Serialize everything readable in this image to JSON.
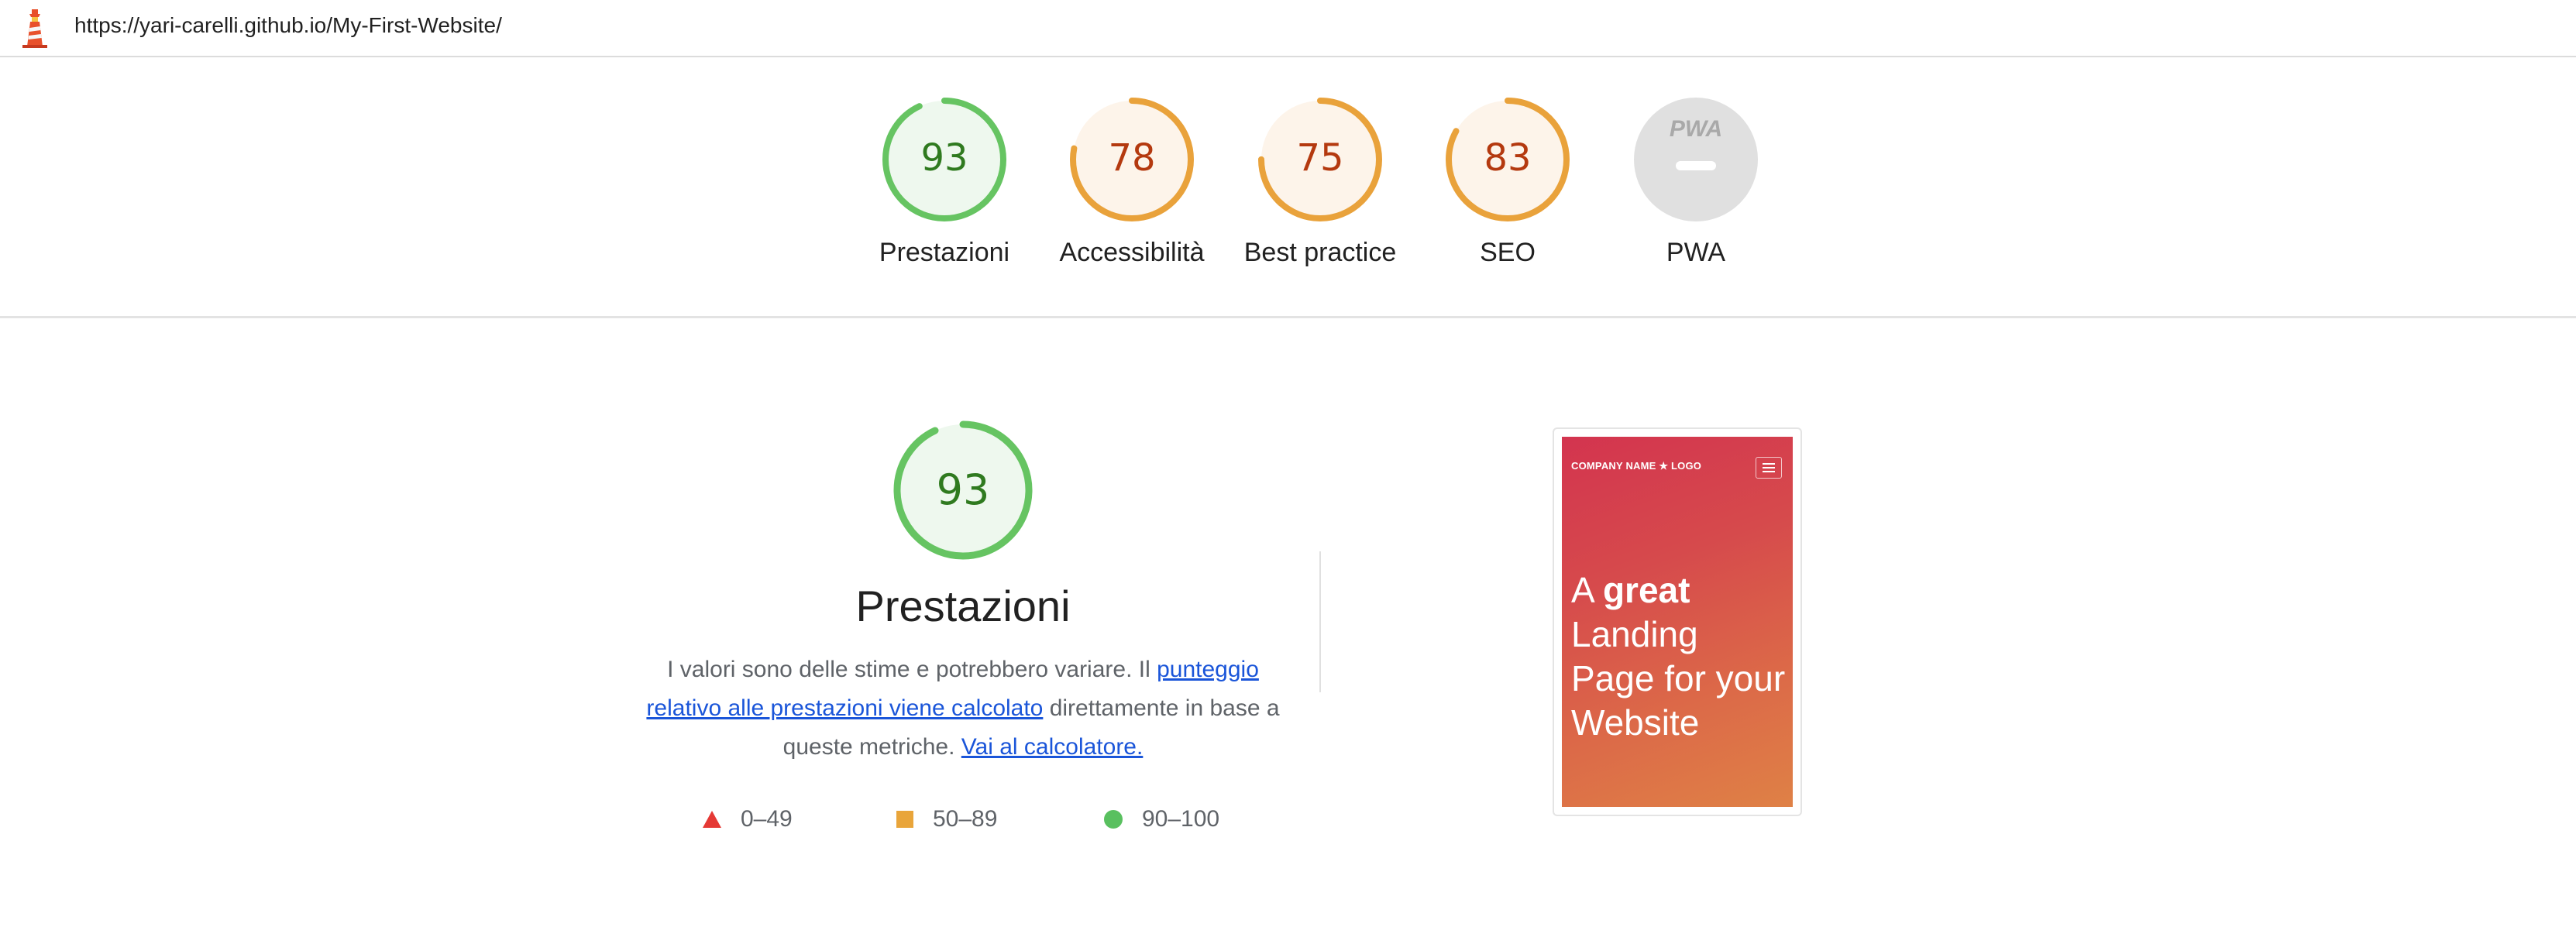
{
  "url": "https://yari-carelli.github.io/My-First-Website/",
  "categories": [
    {
      "label": "Prestazioni",
      "score": 93,
      "rating": "pass"
    },
    {
      "label": "Accessibilità",
      "score": 78,
      "rating": "average"
    },
    {
      "label": "Best practice",
      "score": 75,
      "rating": "average"
    },
    {
      "label": "SEO",
      "score": 83,
      "rating": "average"
    },
    {
      "label": "PWA",
      "score": null,
      "rating": "na"
    }
  ],
  "pwa": {
    "badge_text": "PWA"
  },
  "detail": {
    "score": 93,
    "title": "Prestazioni",
    "desc_part1": "I valori sono delle stime e potrebbero variare. Il ",
    "desc_link1": "punteggio relativo alle prestazioni viene calcolato",
    "desc_part2": " direttamente in base a queste metriche. ",
    "desc_link2": "Vai al calcolatore."
  },
  "legend": [
    {
      "range": "0–49",
      "icon": "triangle-icon",
      "color": "#e53935"
    },
    {
      "range": "50–89",
      "icon": "square-icon",
      "color": "#e9a53a"
    },
    {
      "range": "90–100",
      "icon": "circle-icon",
      "color": "#59c05f"
    }
  ],
  "screenshot": {
    "brand": "COMPANY NAME ★ LOGO",
    "hero_a": "A ",
    "hero_bold": "great",
    "hero_rest": "Landing Page for your Website"
  },
  "colors": {
    "pass_arc": "#66c462",
    "pass_fill": "#eef8ee",
    "pass_text": "#2f7a1f",
    "avg_arc": "#e9a23b",
    "avg_fill": "#fdf4ea",
    "avg_text": "#b4390f",
    "na_fill": "#e0e0e0"
  }
}
